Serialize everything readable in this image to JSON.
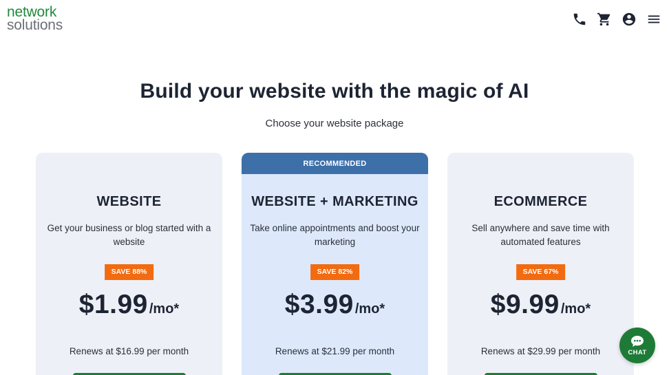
{
  "header": {
    "logo_line1": "network",
    "logo_line2": "solutions",
    "icons": [
      "phone-icon",
      "cart-icon",
      "account-icon",
      "menu-icon"
    ]
  },
  "main": {
    "title": "Build your website with the magic of AI",
    "subtitle": "Choose your website package"
  },
  "plans": [
    {
      "name": "WEBSITE",
      "description": "Get your business or blog started with a website",
      "save_badge": "SAVE 88%",
      "price": "$1.99",
      "period": "/mo*",
      "renewal": "Renews at $16.99 per month",
      "recommended": false
    },
    {
      "banner": "RECOMMENDED",
      "name": "WEBSITE + MARKETING",
      "description": "Take online appointments and boost your marketing",
      "save_badge": "SAVE 82%",
      "price": "$3.99",
      "period": "/mo*",
      "renewal": "Renews at $21.99 per month",
      "recommended": true
    },
    {
      "name": "ECOMMERCE",
      "description": "Sell anywhere and save time with automated features",
      "save_badge": "SAVE 67%",
      "price": "$9.99",
      "period": "/mo*",
      "renewal": "Renews at $29.99 per month",
      "recommended": false
    }
  ],
  "chat": {
    "label": "CHAT",
    "icon": "chat-bubble-icon"
  },
  "colors": {
    "brand_green": "#1e8a3c",
    "cta_green": "#1e7b37",
    "save_orange": "#f26b11",
    "recommended_blue": "#3d6fa8",
    "card_bg": "#edf0f6",
    "card_rec_bg": "#dde9fb"
  }
}
